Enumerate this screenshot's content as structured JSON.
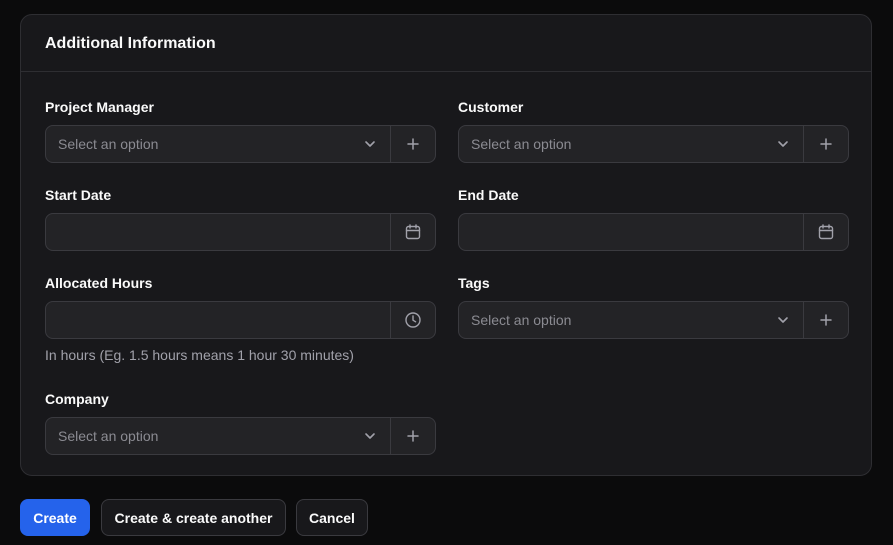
{
  "section": {
    "title": "Additional Information"
  },
  "fields": {
    "project_manager": {
      "label": "Project Manager",
      "placeholder": "Select an option"
    },
    "customer": {
      "label": "Customer",
      "placeholder": "Select an option"
    },
    "start_date": {
      "label": "Start Date",
      "value": ""
    },
    "end_date": {
      "label": "End Date",
      "value": ""
    },
    "allocated_hours": {
      "label": "Allocated Hours",
      "value": "",
      "hint": "In hours (Eg. 1.5 hours means 1 hour 30 minutes)"
    },
    "tags": {
      "label": "Tags",
      "placeholder": "Select an option"
    },
    "company": {
      "label": "Company",
      "placeholder": "Select an option"
    }
  },
  "buttons": {
    "create": "Create",
    "create_another": "Create & create another",
    "cancel": "Cancel"
  },
  "icons": {
    "select": "chevron-down-icon",
    "add": "plus-icon",
    "date": "calendar-icon",
    "time": "clock-icon"
  },
  "colors": {
    "primary": "#2563eb",
    "card_bg": "#18181b",
    "page_bg": "#0b0b0c"
  }
}
